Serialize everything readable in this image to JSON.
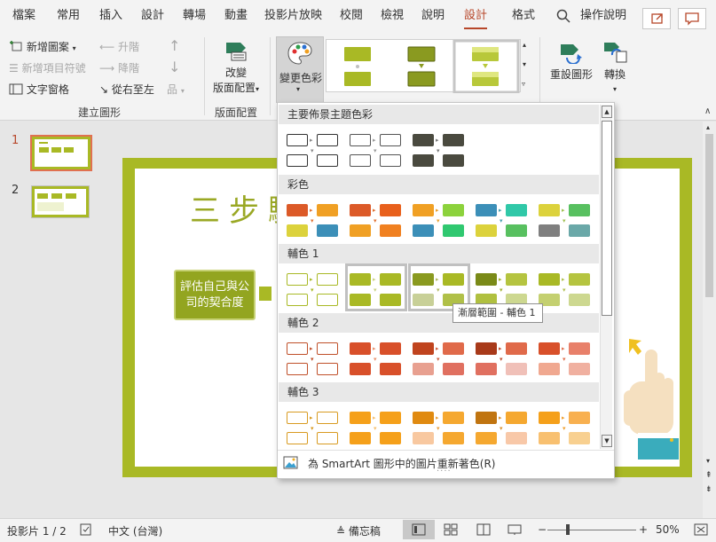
{
  "menu": {
    "tabs": [
      "檔案",
      "常用",
      "插入",
      "設計",
      "轉場",
      "動畫",
      "投影片放映",
      "校閱",
      "檢視",
      "說明",
      "設計",
      "格式"
    ],
    "active_index": 10,
    "search_label": "操作說明"
  },
  "ribbon": {
    "create_graphic": {
      "add_shape": "新增圖案",
      "promote": "升階",
      "add_bullet": "新增項目符號",
      "demote": "降階",
      "text_pane": "文字窗格",
      "right_to_left": "從右至左",
      "group_label": "建立圖形"
    },
    "layouts": {
      "change_layout_line1": "改變",
      "change_layout_line2": "版面配置",
      "group_label": "版面配置"
    },
    "change_colors": "變更色彩",
    "reset_graphic": "重設圖形",
    "convert": "轉換"
  },
  "slides": {
    "thumbnails": [
      {
        "number": "1",
        "selected": true
      },
      {
        "number": "2",
        "selected": false
      }
    ]
  },
  "slide": {
    "title": "三步驟",
    "box_text_line1": "評估自己與公",
    "box_text_line2": "司的契合度"
  },
  "gallery": {
    "sections": [
      {
        "title": "主要佈景主題色彩",
        "options": [
          {
            "style": "outline",
            "c1": "#333333",
            "c2": "#333333",
            "a": "#888888"
          },
          {
            "style": "outline",
            "c1": "#555555",
            "c2": "#555555",
            "a": "#999999"
          },
          {
            "style": "fill",
            "c1": "#4a4a3f",
            "c2": "#4a4a3f",
            "a": "#777777"
          }
        ]
      },
      {
        "title": "彩色",
        "options": [
          {
            "style": "fill",
            "c1": "#dc5a28",
            "c2": "#f0a024",
            "a": "#e07030",
            "c3": "#dcd23c",
            "c4": "#3c8fb8"
          },
          {
            "style": "fill",
            "c1": "#dc5a28",
            "c2": "#e8601c",
            "a": "#e07030",
            "c3": "#f0a024",
            "c4": "#f08020"
          },
          {
            "style": "fill",
            "c1": "#f0a024",
            "c2": "#8cd23c",
            "a": "#e8a030",
            "c3": "#3c8fb8",
            "c4": "#30c870"
          },
          {
            "style": "fill",
            "c1": "#3c8fb8",
            "c2": "#30c8a8",
            "a": "#4aa0b0",
            "c3": "#dcd23c",
            "c4": "#58c060"
          },
          {
            "style": "fill",
            "c1": "#dcd23c",
            "c2": "#58c060",
            "a": "#a0c050",
            "c3": "#7f7f7f",
            "c4": "#6aa8a8"
          }
        ]
      },
      {
        "title": "輔色 1",
        "options": [
          {
            "style": "outline",
            "c1": "#a9b925",
            "c2": "#a9b925",
            "a": "#a9b925"
          },
          {
            "style": "fill",
            "c1": "#a9b925",
            "c2": "#a9b925",
            "a": "#c8d080",
            "selected": true
          },
          {
            "style": "fill",
            "c1": "#8a9a20",
            "c2": "#a9b925",
            "a": "#b0b860",
            "c3": "#c8d098",
            "c4": "#b0c048",
            "selected": true
          },
          {
            "style": "fill",
            "c1": "#7a8a18",
            "c2": "#b5c440",
            "a": "#a0b030",
            "c3": "#b0c040",
            "c4": "#cdd890"
          },
          {
            "style": "fill",
            "c1": "#a9b925",
            "c2": "#b5c440",
            "a": "#b0c050",
            "c3": "#c4d070",
            "c4": "#cdd890"
          }
        ]
      },
      {
        "title": "輔色 2",
        "options": [
          {
            "style": "outline",
            "c1": "#c0502a",
            "c2": "#c0502a",
            "a": "#c0502a"
          },
          {
            "style": "fill",
            "c1": "#d8502a",
            "c2": "#d8502a",
            "a": "#e8906c"
          },
          {
            "style": "fill",
            "c1": "#c0441e",
            "c2": "#e06a4a",
            "a": "#d06040",
            "c3": "#e8a090",
            "c4": "#e07060"
          },
          {
            "style": "fill",
            "c1": "#a83a1a",
            "c2": "#e06a4a",
            "a": "#c05030",
            "c3": "#e07060",
            "c4": "#f0c0b8"
          },
          {
            "style": "fill",
            "c1": "#d8502a",
            "c2": "#e8806a",
            "a": "#e07050",
            "c3": "#f0a890",
            "c4": "#f0b0a0"
          }
        ]
      },
      {
        "title": "輔色 3",
        "options": [
          {
            "style": "outline",
            "c1": "#d89a20",
            "c2": "#d89a20",
            "a": "#d89a20"
          },
          {
            "style": "fill",
            "c1": "#f5a01a",
            "c2": "#f5a01a",
            "a": "#f5c070"
          },
          {
            "style": "fill",
            "c1": "#e08a10",
            "c2": "#f5a830",
            "a": "#e8a040",
            "c3": "#f8c8a0",
            "c4": "#f5a830"
          },
          {
            "style": "fill",
            "c1": "#c07410",
            "c2": "#f5a830",
            "a": "#d89030",
            "c3": "#f5a830",
            "c4": "#f8c8a8"
          },
          {
            "style": "fill",
            "c1": "#f5a01a",
            "c2": "#f8b050",
            "a": "#f0a030",
            "c3": "#f8c070",
            "c4": "#f8d090"
          }
        ]
      }
    ],
    "footer_text": "為 SmartArt 圖形中的圖片重新著色(R)",
    "tooltip": "漸層範圍 - 輔色 1"
  },
  "status": {
    "slide_info": "投影片 1 / 2",
    "language": "中文 (台灣)",
    "notes": "備忘稿",
    "zoom": "50%"
  },
  "colors": {
    "accent": "#b7472a",
    "slide_green": "#a9b925",
    "title_green": "#9aa824"
  }
}
